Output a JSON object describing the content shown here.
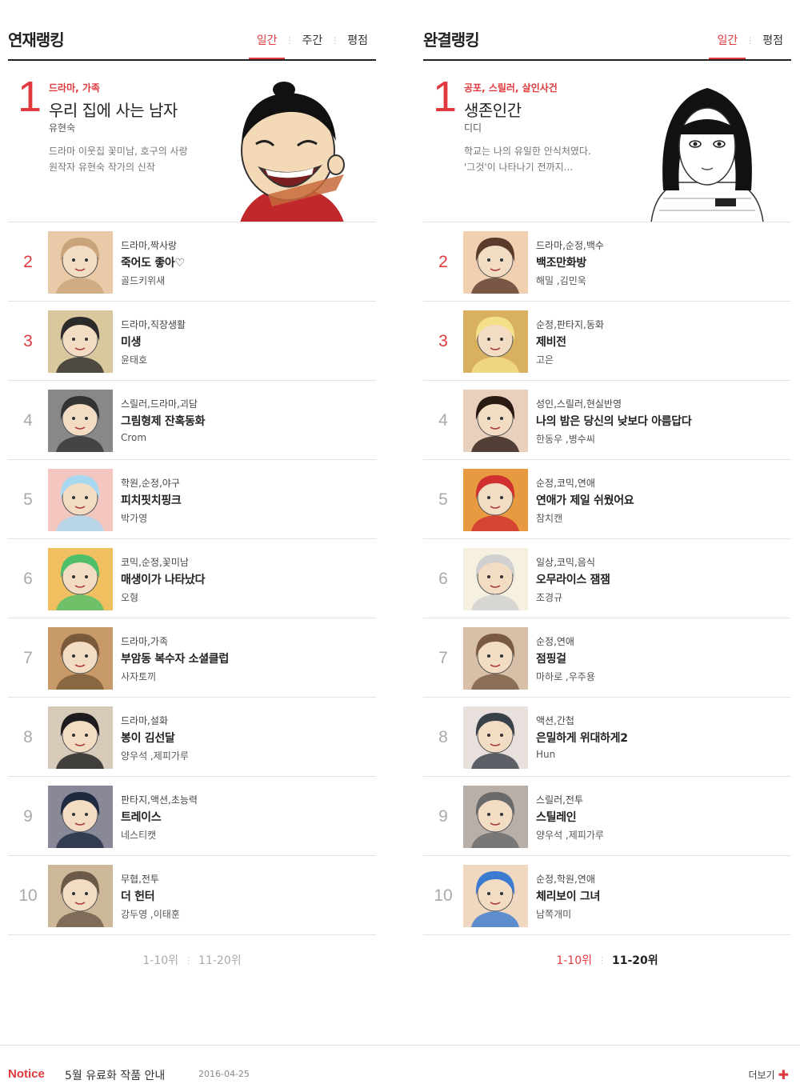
{
  "serial": {
    "heading": "연재랭킹",
    "tabs": [
      "일간",
      "주간",
      "평점"
    ],
    "active_tab": "일간",
    "top": {
      "rank": "1",
      "genre": "드라마, 가족",
      "title": "우리 집에 사는 남자",
      "author": "유현숙",
      "desc_line1": "드라마 이웃집 꽃미남, 호구의 사랑",
      "desc_line2": "원작자 유현숙 작가의 신작"
    },
    "items": [
      {
        "rank": "2",
        "genre": "드라마,짝사랑",
        "title": "죽어도 좋아♡",
        "author": "골드키위새"
      },
      {
        "rank": "3",
        "genre": "드라마,직장생활",
        "title": "미생",
        "author": "윤태호"
      },
      {
        "rank": "4",
        "genre": "스릴러,드라마,괴담",
        "title": "그림형제 잔혹동화",
        "author": "Crom"
      },
      {
        "rank": "5",
        "genre": "학원,순정,야구",
        "title": "피치핏치핑크",
        "author": "박가영"
      },
      {
        "rank": "6",
        "genre": "코믹,순정,꽃미남",
        "title": "매생이가 나타났다",
        "author": "오형"
      },
      {
        "rank": "7",
        "genre": "드라마,가족",
        "title": "부암동 복수자 소셜클럽",
        "author": "사자토끼"
      },
      {
        "rank": "8",
        "genre": "드라마,설화",
        "title": "봉이 김선달",
        "author": "양우석 ,제피가루"
      },
      {
        "rank": "9",
        "genre": "판타지,액션,초능력",
        "title": "트레이스",
        "author": "네스티캣"
      },
      {
        "rank": "10",
        "genre": "무협,전투",
        "title": "더 헌터",
        "author": "강두영 ,이태훈"
      }
    ],
    "pager": [
      "1-10위",
      "11-20위"
    ]
  },
  "completed": {
    "heading": "완결랭킹",
    "tabs": [
      "일간",
      "평점"
    ],
    "active_tab": "일간",
    "top": {
      "rank": "1",
      "genre": "공포, 스릴러, 살인사건",
      "title": "생존인간",
      "author": "디디",
      "desc_line1": "학교는 나의 유일한 안식처였다.",
      "desc_line2": "'그것'이 나타나기 전까지..."
    },
    "items": [
      {
        "rank": "2",
        "genre": "드라마,순정,백수",
        "title": "백조만화방",
        "author": "해밀 ,김민욱"
      },
      {
        "rank": "3",
        "genre": "순정,판타지,동화",
        "title": "제비전",
        "author": "고은"
      },
      {
        "rank": "4",
        "genre": "성인,스릴러,현실반영",
        "title": "나의 밤은 당신의 낮보다 아름답다",
        "author": "한동우 ,병수씨"
      },
      {
        "rank": "5",
        "genre": "순정,코믹,연애",
        "title": "연애가 제일 쉬웠어요",
        "author": "참치캔"
      },
      {
        "rank": "6",
        "genre": "일상,코믹,음식",
        "title": "오무라이스 잼잼",
        "author": "조경규"
      },
      {
        "rank": "7",
        "genre": "순정,연애",
        "title": "점핑걸",
        "author": "마하로 ,우주용"
      },
      {
        "rank": "8",
        "genre": "액션,간첩",
        "title": "은밀하게 위대하게2",
        "author": "Hun"
      },
      {
        "rank": "9",
        "genre": "스릴러,전투",
        "title": "스틸레인",
        "author": "양우석 ,제피가루"
      },
      {
        "rank": "10",
        "genre": "순정,학원,연애",
        "title": "체리보이 그녀",
        "author": "남쪽개미"
      }
    ],
    "pager": [
      "1-10위",
      "11-20위"
    ]
  },
  "notice": {
    "label": "Notice",
    "text": "5월 유료화 작품 안내",
    "date": "2016-04-25",
    "more": "더보기"
  },
  "colors": {
    "accent": "#e0393e",
    "rank_gray": "#aaaaaa",
    "divider": "#e2e2e2"
  }
}
